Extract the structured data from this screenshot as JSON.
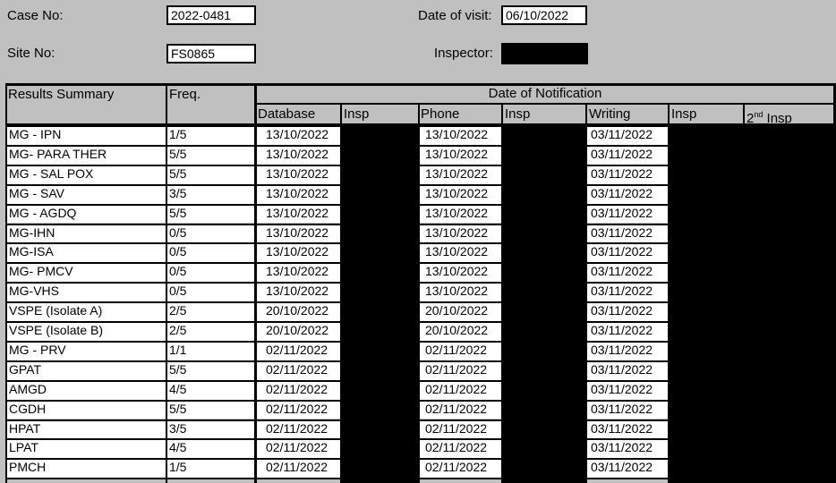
{
  "header": {
    "case_no_label": "Case No:",
    "case_no_value": "2022-0481",
    "date_of_visit_label": "Date of visit:",
    "date_of_visit_value": "06/10/2022",
    "site_no_label": "Site No:",
    "site_no_value": "FS0865",
    "inspector_label": "Inspector:",
    "inspector_value_redacted": true
  },
  "table": {
    "col_results": "Results Summary",
    "col_freq": "Freq.",
    "group_header": "Date of Notification",
    "sub_database": "Database",
    "sub_insp1": "Insp",
    "sub_phone": "Phone",
    "sub_insp2": "Insp",
    "sub_writing": "Writing",
    "sub_insp3": "Insp",
    "sub_2nd_main": "2",
    "sub_2nd_sup": "nd",
    "sub_2nd_rest": " Insp",
    "rows": [
      {
        "name": "MG - IPN",
        "freq": "1/5",
        "database": "13/10/2022",
        "phone": "13/10/2022",
        "writing": "03/11/2022"
      },
      {
        "name": "MG-  PARA THER",
        "freq": "5/5",
        "database": "13/10/2022",
        "phone": "13/10/2022",
        "writing": "03/11/2022"
      },
      {
        "name": "MG - SAL POX",
        "freq": "5/5",
        "database": "13/10/2022",
        "phone": "13/10/2022",
        "writing": "03/11/2022"
      },
      {
        "name": "MG - SAV",
        "freq": "3/5",
        "database": "13/10/2022",
        "phone": "13/10/2022",
        "writing": "03/11/2022"
      },
      {
        "name": "MG - AGDQ",
        "freq": "5/5",
        "database": "13/10/2022",
        "phone": "13/10/2022",
        "writing": "03/11/2022"
      },
      {
        "name": "MG-IHN",
        "freq": "0/5",
        "database": "13/10/2022",
        "phone": "13/10/2022",
        "writing": "03/11/2022"
      },
      {
        "name": "MG-ISA",
        "freq": "0/5",
        "database": "13/10/2022",
        "phone": "13/10/2022",
        "writing": "03/11/2022"
      },
      {
        "name": "MG- PMCV",
        "freq": "0/5",
        "database": "13/10/2022",
        "phone": "13/10/2022",
        "writing": "03/11/2022"
      },
      {
        "name": "MG-VHS",
        "freq": "0/5",
        "database": "13/10/2022",
        "phone": "13/10/2022",
        "writing": "03/11/2022"
      },
      {
        "name": "VSPE (Isolate A)",
        "freq": "2/5",
        "database": "20/10/2022",
        "phone": "20/10/2022",
        "writing": "03/11/2022"
      },
      {
        "name": "VSPE (Isolate B)",
        "freq": "2/5",
        "database": "20/10/2022",
        "phone": "20/10/2022",
        "writing": "03/11/2022"
      },
      {
        "name": "MG - PRV",
        "freq": "1/1",
        "database": "02/11/2022",
        "phone": "02/11/2022",
        "writing": "03/11/2022"
      },
      {
        "name": "GPAT",
        "freq": "5/5",
        "database": "02/11/2022",
        "phone": "02/11/2022",
        "writing": "03/11/2022"
      },
      {
        "name": "AMGD",
        "freq": "4/5",
        "database": "02/11/2022",
        "phone": "02/11/2022",
        "writing": "03/11/2022"
      },
      {
        "name": "CGDH",
        "freq": "5/5",
        "database": "02/11/2022",
        "phone": "02/11/2022",
        "writing": "03/11/2022"
      },
      {
        "name": "HPAT",
        "freq": "3/5",
        "database": "02/11/2022",
        "phone": "02/11/2022",
        "writing": "03/11/2022"
      },
      {
        "name": "LPAT",
        "freq": "4/5",
        "database": "02/11/2022",
        "phone": "02/11/2022",
        "writing": "03/11/2022"
      },
      {
        "name": "PMCH",
        "freq": "1/5",
        "database": "02/11/2022",
        "phone": "02/11/2022",
        "writing": "03/11/2022"
      }
    ]
  }
}
